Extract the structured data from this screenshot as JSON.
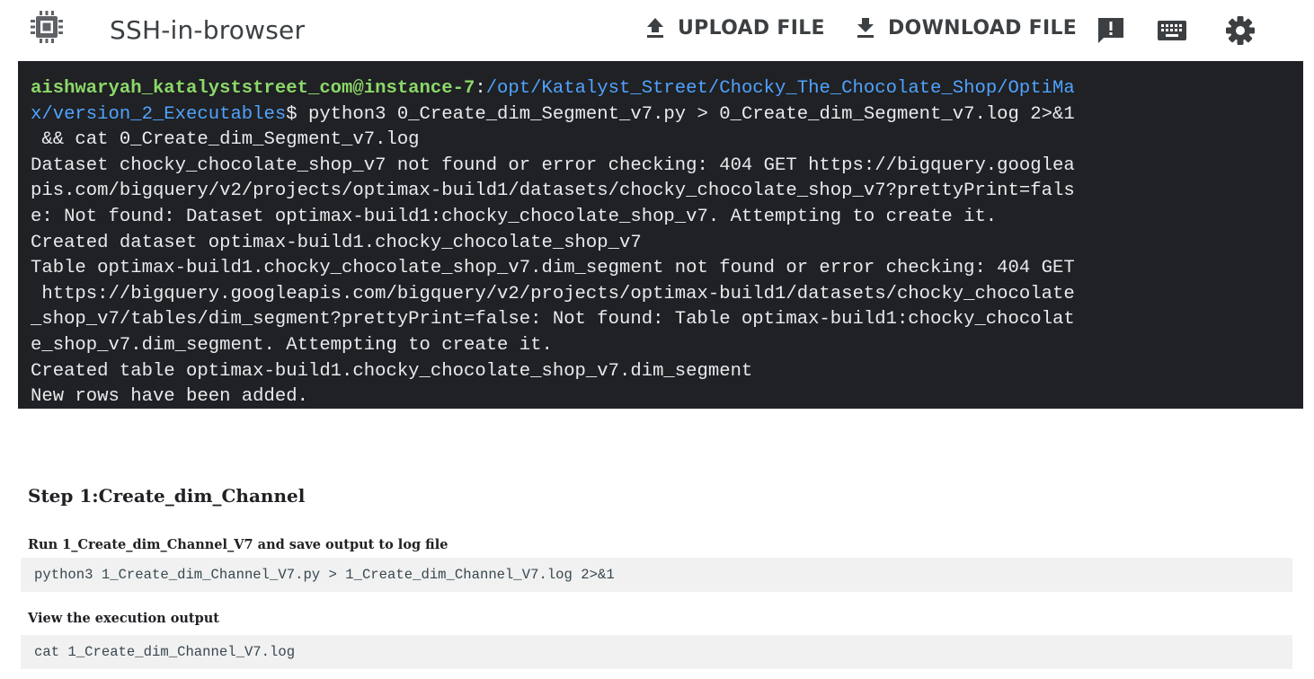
{
  "header": {
    "app_title": "SSH-in-browser",
    "upload_label": "UPLOAD FILE",
    "download_label": "DOWNLOAD FILE",
    "icons": [
      "chip-icon",
      "upload-icon",
      "download-icon",
      "feedback-icon",
      "keyboard-icon",
      "gear-icon"
    ]
  },
  "terminal": {
    "prompt_user": "aishwaryah_katalyststreet_com@instance-7",
    "prompt_sep": ":",
    "prompt_path_1": "/opt/Katalyst_Street/Chocky_The_Chocolate_Shop/OptiMa",
    "prompt_path_2": "x/version_2_Executables",
    "command_1": "$ python3 0_Create_dim_Segment_v7.py > 0_Create_dim_Segment_v7.log 2>&1",
    "command_2": " && cat 0_Create_dim_Segment_v7.log",
    "output": [
      "Dataset chocky_chocolate_shop_v7 not found or error checking: 404 GET https://bigquery.googlea",
      "pis.com/bigquery/v2/projects/optimax-build1/datasets/chocky_chocolate_shop_v7?prettyPrint=fals",
      "e: Not found: Dataset optimax-build1:chocky_chocolate_shop_v7. Attempting to create it.",
      "Created dataset optimax-build1.chocky_chocolate_shop_v7",
      "Table optimax-build1.chocky_chocolate_shop_v7.dim_segment not found or error checking: 404 GET",
      " https://bigquery.googleapis.com/bigquery/v2/projects/optimax-build1/datasets/chocky_chocolate",
      "_shop_v7/tables/dim_segment?prettyPrint=false: Not found: Table optimax-build1:chocky_chocolat",
      "e_shop_v7.dim_segment. Attempting to create it.",
      "Created table optimax-build1.chocky_chocolate_shop_v7.dim_segment",
      "New rows have been added."
    ]
  },
  "doc": {
    "step_title": "Step 1:Create_dim_Channel",
    "sub1": "Run 1_Create_dim_Channel_V7 and save output to log file",
    "code1": "python3 1_Create_dim_Channel_V7.py > 1_Create_dim_Channel_V7.log 2>&1",
    "sub2": "View the execution output",
    "code2": "cat 1_Create_dim_Channel_V7.log"
  },
  "colors": {
    "terminal_bg": "#202124",
    "prompt_user": "#8bd86a",
    "prompt_path": "#4fa3ff",
    "code_bg": "#f1f1f1"
  }
}
